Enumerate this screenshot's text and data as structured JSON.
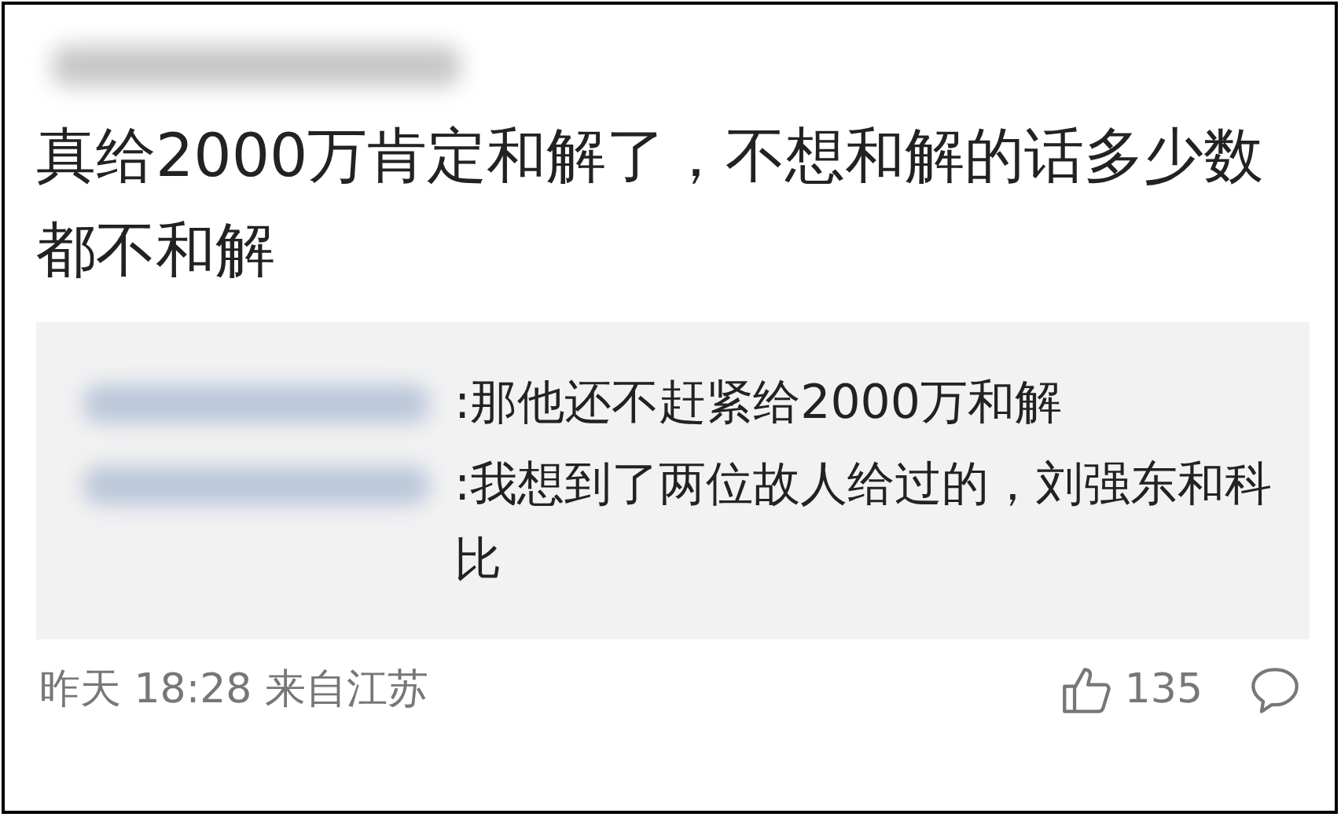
{
  "comment": {
    "author": {
      "kind": "blurred"
    },
    "text": "真给2000万肯定和解了，不想和解的话多少数都不和解",
    "replies": [
      {
        "author": {
          "kind": "blurred"
        },
        "text": ":那他还不赶紧给2000万和解"
      },
      {
        "author": {
          "kind": "blurred"
        },
        "text": ":我想到了两位故人给过的，刘强东和科比"
      }
    ],
    "footer": {
      "time": "昨天 18:28 来自江苏",
      "likes": "135"
    }
  }
}
